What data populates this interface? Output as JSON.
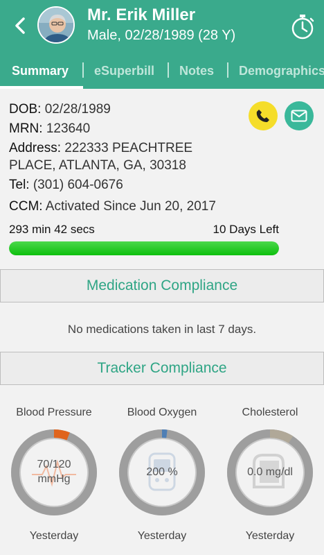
{
  "header": {
    "name": "Mr. Erik Miller",
    "subtitle": "Male, 02/28/1989 (28 Y)",
    "color": "#3aaa8c"
  },
  "tabs": [
    {
      "label": "Summary",
      "active": true
    },
    {
      "label": "eSuperbill",
      "active": false
    },
    {
      "label": "Notes",
      "active": false
    },
    {
      "label": "Demographics",
      "active": false
    }
  ],
  "patient": {
    "dob_label": "DOB:",
    "dob": "02/28/1989",
    "mrn_label": "MRN:",
    "mrn": "123640",
    "address_label": "Address:",
    "address_line1": "222333 PEACHTREE",
    "address_line2": "PLACE, ATLANTA, GA, 30318",
    "tel_label": "Tel:",
    "tel": "(301) 604-0676",
    "ccm_label": "CCM:",
    "ccm": "Activated Since Jun 20, 2017"
  },
  "ccm_timer": {
    "elapsed": "293 min 42 secs",
    "days_left": "10 Days Left",
    "progress_fraction": 1.0
  },
  "medication": {
    "title": "Medication Compliance",
    "empty_text": "No medications taken in last 7 days."
  },
  "trackers": {
    "title": "Tracker Compliance",
    "items": [
      {
        "label": "Blood Pressure",
        "value": "70/120\nmmHg",
        "when": "Yesterday",
        "fraction": 0.06,
        "color": "#e0641c"
      },
      {
        "label": "Blood Oxygen",
        "value": "200 %",
        "when": "Yesterday",
        "fraction": 0.02,
        "color": "#4f7fb5"
      },
      {
        "label": "Cholesterol",
        "value": "0.0 mg/dl",
        "when": "Yesterday",
        "fraction": 0.09,
        "color": "#b0a898"
      }
    ]
  }
}
